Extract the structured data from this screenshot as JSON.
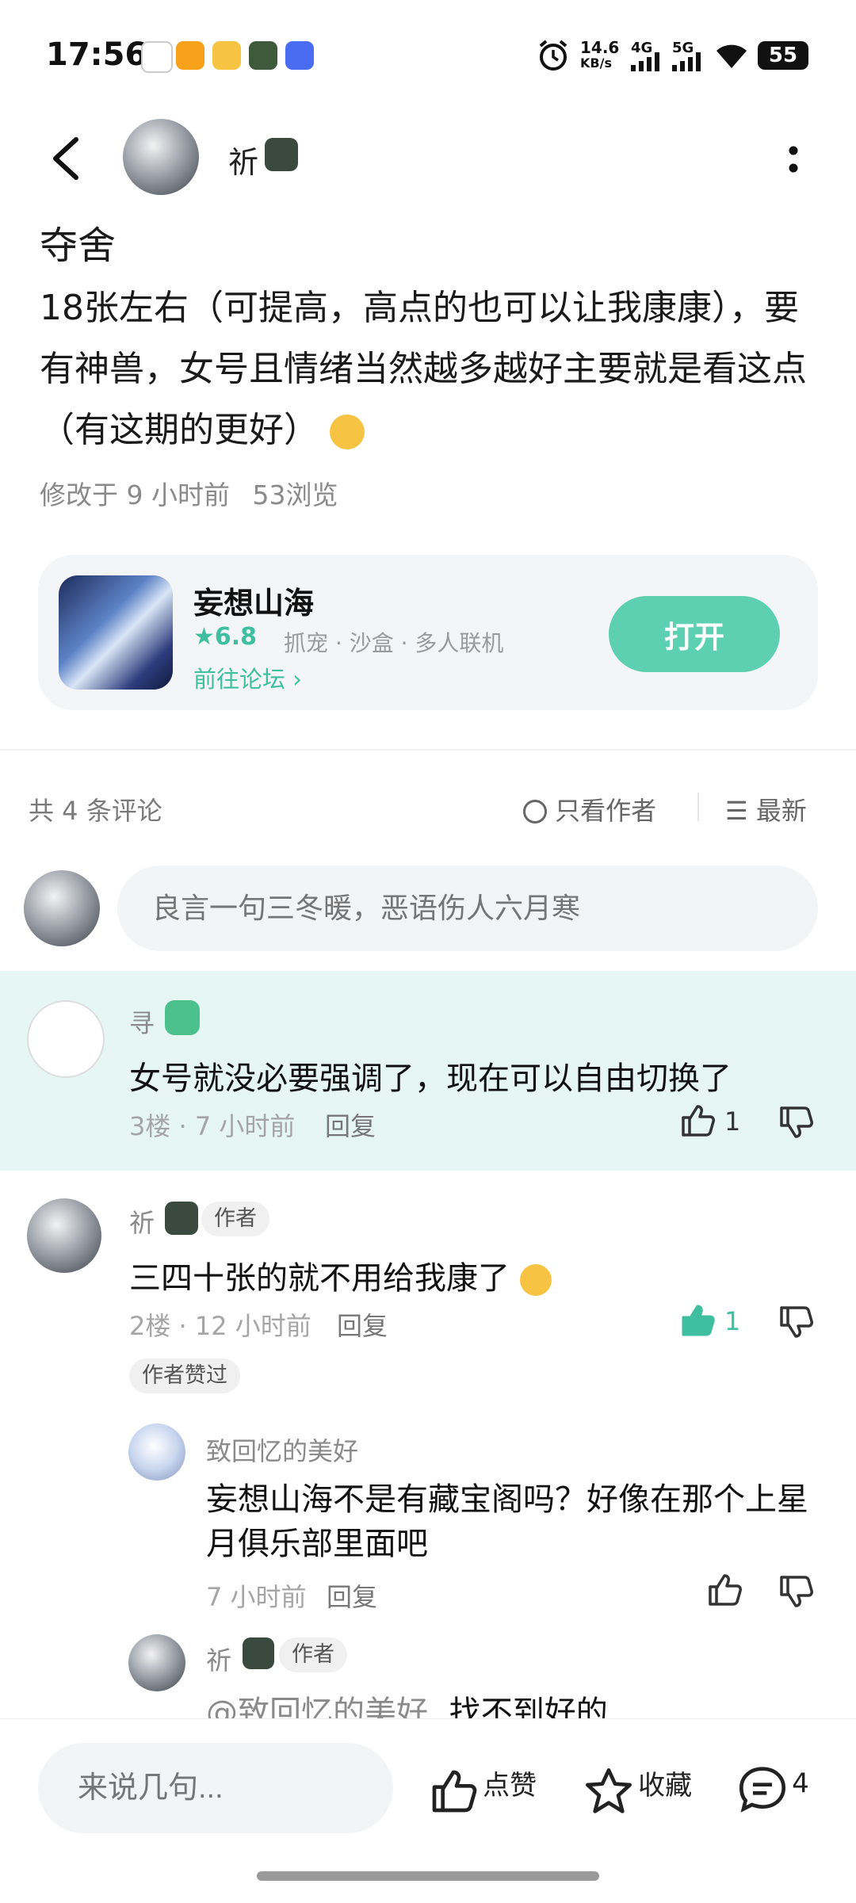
{
  "status_bar": {
    "time": "17:56",
    "net_speed_value": "14.6",
    "net_speed_unit": "KB/s",
    "net1": "4G",
    "net2": "5G",
    "battery": "55"
  },
  "header": {
    "author_name": "祈"
  },
  "post": {
    "title": "夺舍",
    "body": "18张左右（可提高，高点的也可以让我康康），要有神兽，女号且情绪当然越多越好主要就是看这点（有这期的更好）",
    "modified": "修改于 9 小时前",
    "views": "53浏览"
  },
  "game_card": {
    "name": "妄想山海",
    "rating": "6.8",
    "tags": "抓宠 · 沙盒 · 多人联机",
    "forum_link": "前往论坛",
    "open_label": "打开"
  },
  "comments_header": {
    "count": "共 4 条评论",
    "only_author": "只看作者",
    "sort": "最新"
  },
  "comment_input": {
    "placeholder": "良言一句三冬暖，恶语伤人六月寒"
  },
  "comments": [
    {
      "name": "寻",
      "text": "女号就没必要强调了，现在可以自由切换了",
      "floor": "3楼",
      "time": "7 小时前",
      "reply": "回复",
      "likes": "1"
    },
    {
      "name": "祈",
      "author_tag": "作者",
      "text": "三四十张的就不用给我康了",
      "floor": "2楼",
      "time": "12 小时前",
      "reply": "回复",
      "likes": "1",
      "author_liked": "作者赞过",
      "replies": [
        {
          "name": "致回忆的美好",
          "text": "妄想山海不是有藏宝阁吗？好像在那个上星月俱乐部里面吧",
          "time": "7 小时前",
          "reply": "回复"
        },
        {
          "name": "祈",
          "author_tag": "作者",
          "mention": "@致回忆的美好",
          "text": "找不到好的"
        }
      ]
    }
  ],
  "bottom_bar": {
    "input_placeholder": "来说几句...",
    "like_label": "点赞",
    "fav_label": "收藏",
    "comment_count": "4"
  },
  "colors": {
    "accent": "#5ed0b2",
    "highlight_bg": "#e6f6f3",
    "liked": "#3fbf9f"
  }
}
